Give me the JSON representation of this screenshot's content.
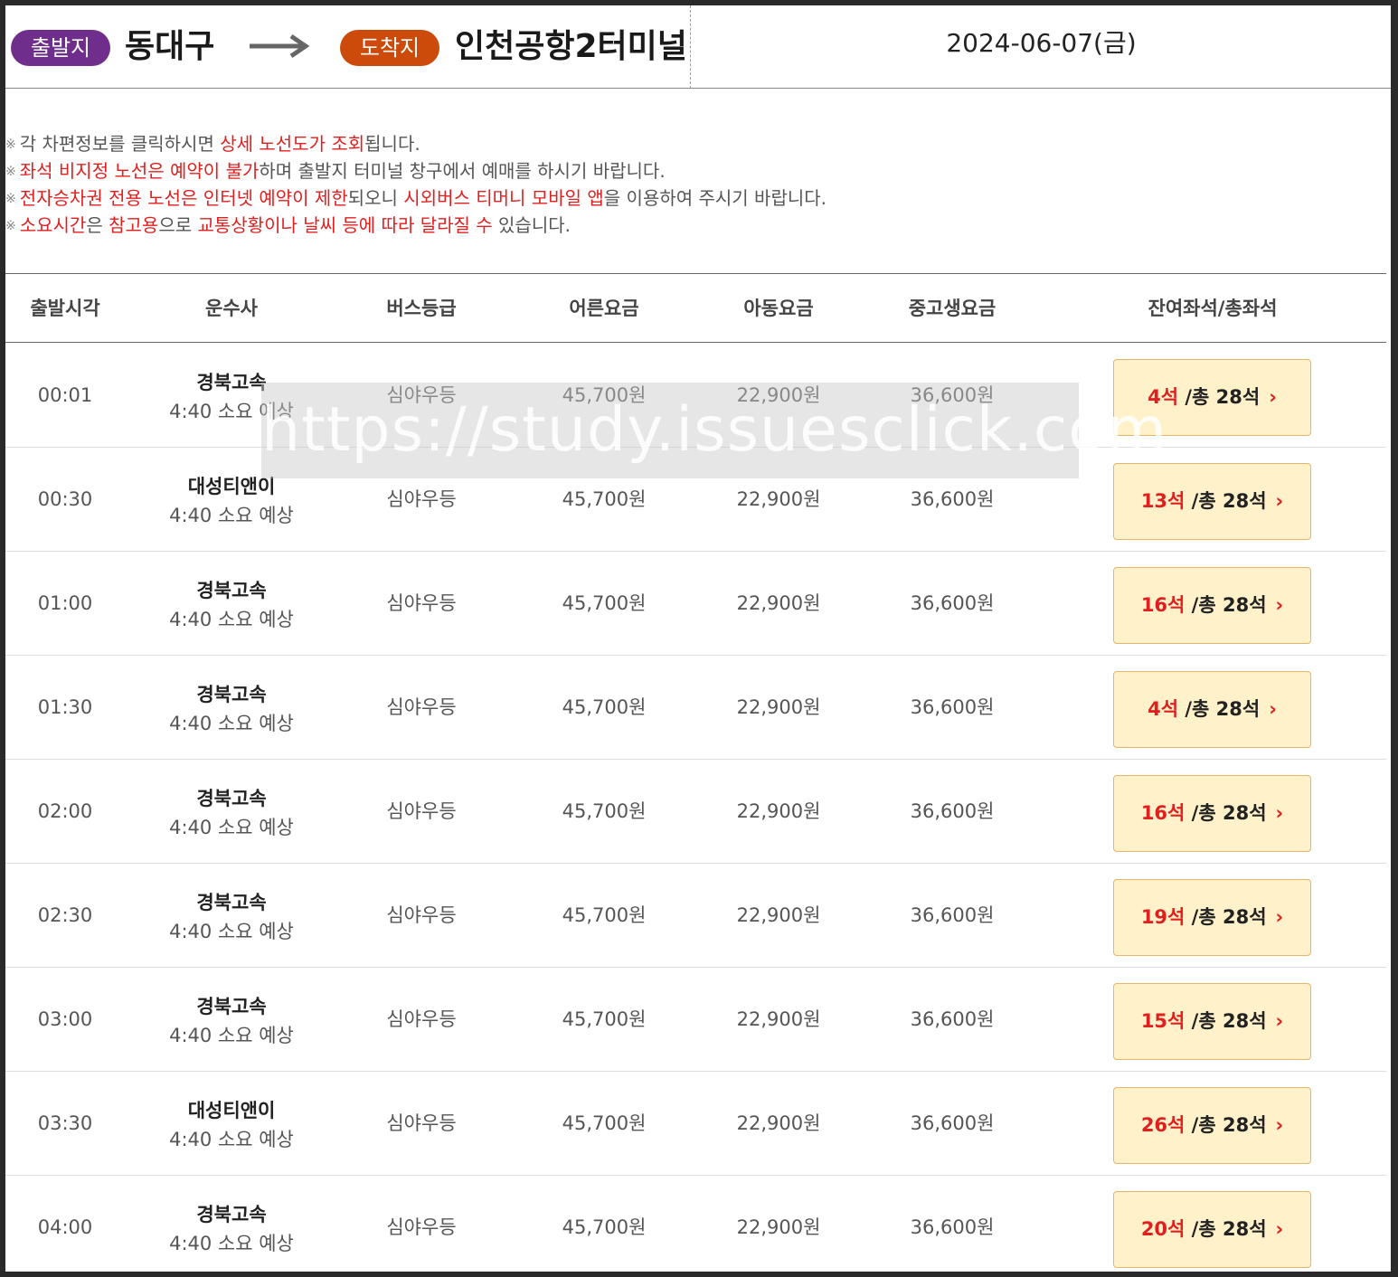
{
  "route": {
    "departure_label": "출발지",
    "departure": "동대구",
    "arrival_label": "도착지",
    "arrival": "인천공항2터미널",
    "date": "2024-06-07(금)",
    "arrow_icon": "arrow-right-icon",
    "departure_color": "#6f2e8c",
    "arrival_color": "#cc4b0a"
  },
  "notices": [
    [
      {
        "t": "각 차편정보를 클릭하시면 ",
        "r": false
      },
      {
        "t": "상세 노선도가 조회",
        "r": true
      },
      {
        "t": "됩니다.",
        "r": false
      }
    ],
    [
      {
        "t": "좌석 비지정 노선은 예약이 불가",
        "r": true
      },
      {
        "t": "하며 출발지 터미널 창구에서 예매를 하시기 바랍니다.",
        "r": false
      }
    ],
    [
      {
        "t": "전자승차권 전용 노선은 인터넷 예약이 제한",
        "r": true
      },
      {
        "t": "되오니 ",
        "r": false
      },
      {
        "t": "시외버스 티머니 모바일 앱",
        "r": true
      },
      {
        "t": "을 이용하여 주시기 바랍니다.",
        "r": false
      }
    ],
    [
      {
        "t": "소요시간",
        "r": true
      },
      {
        "t": "은 ",
        "r": false
      },
      {
        "t": "참고용",
        "r": true
      },
      {
        "t": "으로 ",
        "r": false
      },
      {
        "t": "교통상황이나 날씨 등에 따라 달라질 수",
        "r": true
      },
      {
        "t": " 있습니다.",
        "r": false
      }
    ]
  ],
  "table": {
    "headers": {
      "time": "출발시각",
      "company": "운수사",
      "grade": "버스등급",
      "adult": "어른요금",
      "child": "아동요금",
      "student": "중고생요금",
      "seats": "잔여좌석/총좌석"
    },
    "rows": [
      {
        "time": "00:01",
        "company": "경북고속",
        "duration": "4:40 소요 예상",
        "grade": "심야우등",
        "adult": "45,700원",
        "child": "22,900원",
        "student": "36,600원",
        "avail": "4석",
        "total": " /총 28석"
      },
      {
        "time": "00:30",
        "company": "대성티앤이",
        "duration": "4:40 소요 예상",
        "grade": "심야우등",
        "adult": "45,700원",
        "child": "22,900원",
        "student": "36,600원",
        "avail": "13석",
        "total": " /총 28석"
      },
      {
        "time": "01:00",
        "company": "경북고속",
        "duration": "4:40 소요 예상",
        "grade": "심야우등",
        "adult": "45,700원",
        "child": "22,900원",
        "student": "36,600원",
        "avail": "16석",
        "total": " /총 28석"
      },
      {
        "time": "01:30",
        "company": "경북고속",
        "duration": "4:40 소요 예상",
        "grade": "심야우등",
        "adult": "45,700원",
        "child": "22,900원",
        "student": "36,600원",
        "avail": "4석",
        "total": " /총 28석"
      },
      {
        "time": "02:00",
        "company": "경북고속",
        "duration": "4:40 소요 예상",
        "grade": "심야우등",
        "adult": "45,700원",
        "child": "22,900원",
        "student": "36,600원",
        "avail": "16석",
        "total": " /총 28석"
      },
      {
        "time": "02:30",
        "company": "경북고속",
        "duration": "4:40 소요 예상",
        "grade": "심야우등",
        "adult": "45,700원",
        "child": "22,900원",
        "student": "36,600원",
        "avail": "19석",
        "total": " /총 28석"
      },
      {
        "time": "03:00",
        "company": "경북고속",
        "duration": "4:40 소요 예상",
        "grade": "심야우등",
        "adult": "45,700원",
        "child": "22,900원",
        "student": "36,600원",
        "avail": "15석",
        "total": " /총 28석"
      },
      {
        "time": "03:30",
        "company": "대성티앤이",
        "duration": "4:40 소요 예상",
        "grade": "심야우등",
        "adult": "45,700원",
        "child": "22,900원",
        "student": "36,600원",
        "avail": "26석",
        "total": " /총 28석"
      },
      {
        "time": "04:00",
        "company": "경북고속",
        "duration": "4:40 소요 예상",
        "grade": "심야우등",
        "adult": "45,700원",
        "child": "22,900원",
        "student": "36,600원",
        "avail": "20석",
        "total": " /총 28석"
      }
    ],
    "seat_button_icon": "chevron-right-icon",
    "seat_button_bg": "#fff1c9",
    "available_color": "#e01f1f"
  },
  "watermark": "https://study.issuesclick.com"
}
